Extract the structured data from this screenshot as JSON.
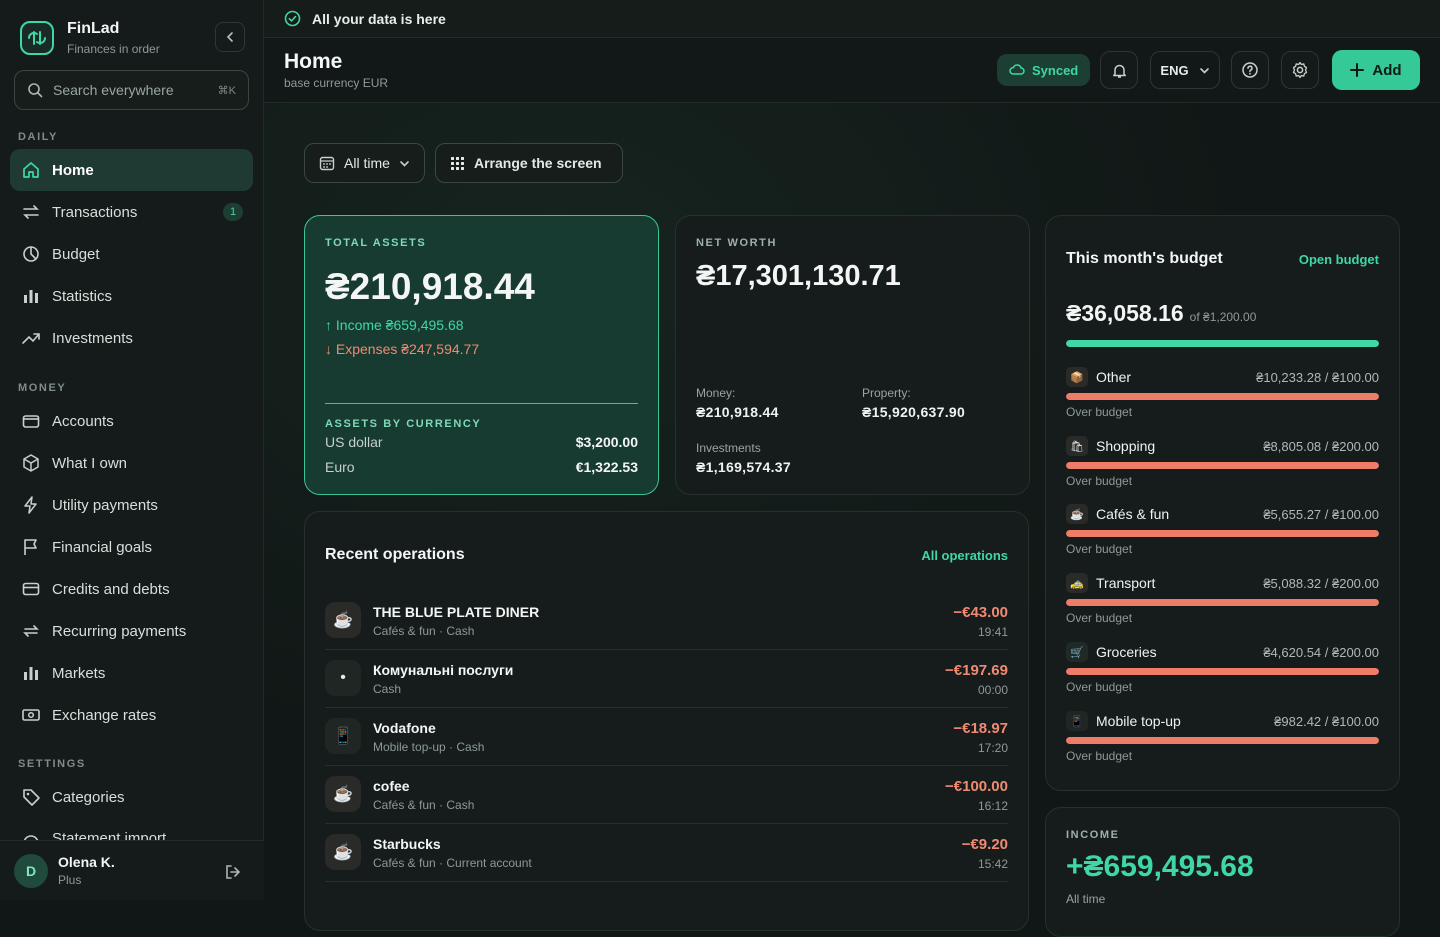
{
  "brand": {
    "name": "FinLad",
    "tagline": "Finances in order"
  },
  "search": {
    "placeholder": "Search everywhere",
    "shortcut": "⌘K"
  },
  "sidebar": {
    "sections": {
      "daily": "DAILY",
      "money": "MONEY",
      "settings": "SETTINGS"
    },
    "items": [
      {
        "label": "Home",
        "icon": "home-icon",
        "active": true
      },
      {
        "label": "Transactions",
        "icon": "transfer-icon",
        "badge": "1"
      },
      {
        "label": "Budget",
        "icon": "pie-icon"
      },
      {
        "label": "Statistics",
        "icon": "bar-chart-icon"
      },
      {
        "label": "Investments",
        "icon": "trend-up-icon"
      },
      {
        "label": "Accounts",
        "icon": "wallet-icon"
      },
      {
        "label": "What I own",
        "icon": "box-icon"
      },
      {
        "label": "Utility payments",
        "icon": "bolt-icon"
      },
      {
        "label": "Financial goals",
        "icon": "flag-icon"
      },
      {
        "label": "Credits and debts",
        "icon": "card-icon"
      },
      {
        "label": "Recurring payments",
        "icon": "repeat-icon"
      },
      {
        "label": "Markets",
        "icon": "bar-chart-icon"
      },
      {
        "label": "Exchange rates",
        "icon": "banknote-icon"
      },
      {
        "label": "Categories",
        "icon": "tag-icon"
      },
      {
        "label": "Statement import",
        "icon": "import-icon"
      }
    ]
  },
  "user": {
    "initial": "D",
    "name": "Olena K.",
    "plan": "Plus"
  },
  "topbar": {
    "message": "All your data is here"
  },
  "header": {
    "title": "Home",
    "subtitle": "base currency EUR",
    "synced": "Synced",
    "lang": "ENG",
    "add": "Add"
  },
  "controls": {
    "period": "All time",
    "arrange": "Arrange the screen"
  },
  "total_assets": {
    "label": "TOTAL ASSETS",
    "amount": "₴210,918.44",
    "income": "↑ Income ₴659,495.68",
    "expenses": "↓ Expenses ₴247,594.77",
    "by_currency_label": "ASSETS BY CURRENCY",
    "currencies": [
      {
        "name": "US dollar",
        "value": "$3,200.00"
      },
      {
        "name": "Euro",
        "value": "€1,322.53"
      }
    ]
  },
  "net_worth": {
    "label": "NET WORTH",
    "amount": "₴17,301,130.71",
    "money_label": "Money:",
    "money": "₴210,918.44",
    "property_label": "Property:",
    "property": "₴15,920,637.90",
    "investments_label": "Investments",
    "investments": "₴1,169,574.37"
  },
  "operations": {
    "title": "Recent operations",
    "link": "All operations",
    "rows": [
      {
        "name": "THE BLUE PLATE DINER",
        "cat": "Cafés & fun · Cash",
        "amount": "−€43.00",
        "time": "19:41",
        "icon": "☕"
      },
      {
        "name": "Комунальні послуги",
        "cat": "Cash",
        "amount": "−€197.69",
        "time": "00:00",
        "icon": "•"
      },
      {
        "name": "Vodafone",
        "cat": "Mobile top-up · Cash",
        "amount": "−€18.97",
        "time": "17:20",
        "icon": "📱"
      },
      {
        "name": "cofee",
        "cat": "Cafés & fun · Cash",
        "amount": "−€100.00",
        "time": "16:12",
        "icon": "☕"
      },
      {
        "name": "Starbucks",
        "cat": "Cafés & fun · Current account",
        "amount": "−€9.20",
        "time": "15:42",
        "icon": "☕"
      }
    ]
  },
  "budget": {
    "title": "This month's budget",
    "link": "Open budget",
    "amount": "₴36,058.16",
    "of": "of ₴1,200.00",
    "progress": 1.0,
    "categories": [
      {
        "name": "Other",
        "value": "₴10,233.28 / ₴100.00",
        "status": "Over budget",
        "icon": "📦"
      },
      {
        "name": "Shopping",
        "value": "₴8,805.08 / ₴200.00",
        "status": "Over budget",
        "icon": "🛍"
      },
      {
        "name": "Cafés & fun",
        "value": "₴5,655.27 / ₴100.00",
        "status": "Over budget",
        "icon": "☕"
      },
      {
        "name": "Transport",
        "value": "₴5,088.32 / ₴200.00",
        "status": "Over budget",
        "icon": "🚕"
      },
      {
        "name": "Groceries",
        "value": "₴4,620.54 / ₴200.00",
        "status": "Over budget",
        "icon": "🛒"
      },
      {
        "name": "Mobile top-up",
        "value": "₴982.42 / ₴100.00",
        "status": "Over budget",
        "icon": "📱"
      }
    ]
  },
  "income": {
    "label": "INCOME",
    "amount": "+₴659,495.68",
    "period": "All time"
  },
  "colors": {
    "accent": "#3fd7a6",
    "negative": "#ef7c67",
    "background": "#111716"
  }
}
